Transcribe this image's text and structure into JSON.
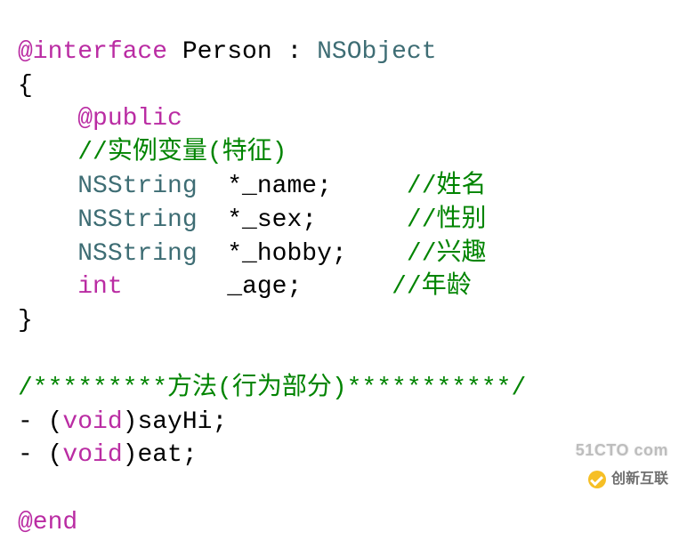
{
  "code": {
    "line1": {
      "iface": "@interface",
      "class_name": "Person",
      "colon": " : ",
      "superclass": "NSObject"
    },
    "line2": "{",
    "line3_public": "    @public",
    "line4_comment": "    //实例变量(特征)",
    "line5": {
      "type": "NSString",
      "decl": "*_name;",
      "comment": "//姓名"
    },
    "line6": {
      "type": "NSString",
      "decl": "*_sex;",
      "comment": "//性别"
    },
    "line7": {
      "type": "NSString",
      "decl": "*_hobby;",
      "comment": "//兴趣"
    },
    "line8": {
      "type": "int",
      "decl": "_age;",
      "comment": "//年龄"
    },
    "line9": "}",
    "line10": "",
    "line11_comment": "/*********方法(行为部分)***********/",
    "line12": {
      "prefix": "- (",
      "kw": "void",
      "suffix": ")sayHi;"
    },
    "line13": {
      "prefix": "- (",
      "kw": "void",
      "suffix": ")eat;"
    },
    "line14": "",
    "line15_end": "@end"
  },
  "watermark1": "51CTO com",
  "watermark2": "创新互联"
}
